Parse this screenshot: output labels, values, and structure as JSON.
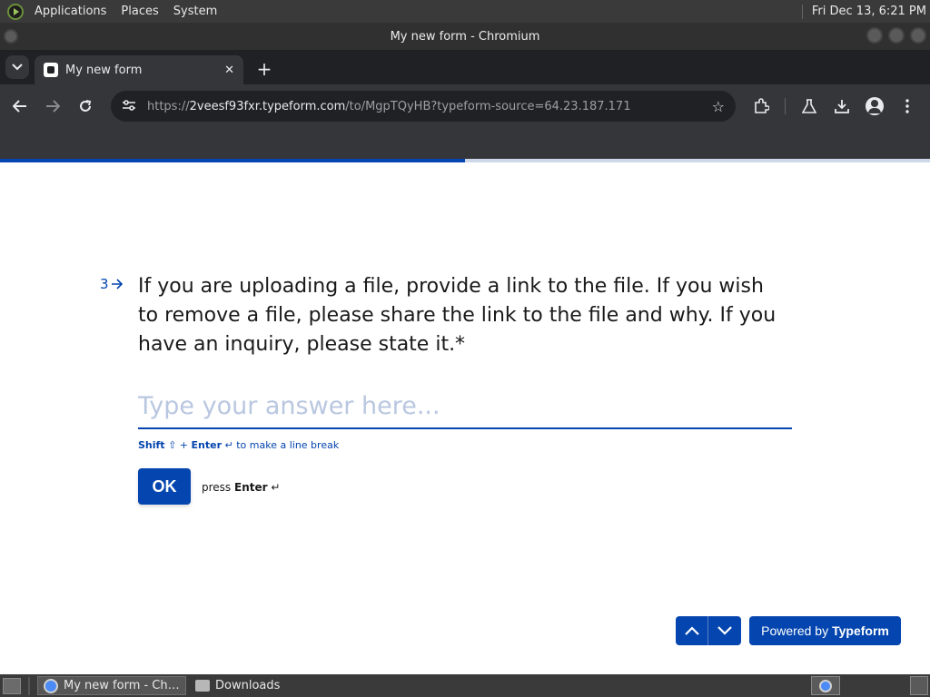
{
  "system_panel": {
    "menus": [
      "Applications",
      "Places",
      "System"
    ],
    "clock": "Fri Dec 13,  6:21 PM"
  },
  "window": {
    "title": "My new form - Chromium"
  },
  "browser": {
    "tab_title": "My new form",
    "url_prefix": "https://",
    "url_host": "2veesf93fxr.typeform.com",
    "url_path": "/to/MgpTQyHB?typeform-source=64.23.187.171"
  },
  "form": {
    "progress_fraction": 0.5,
    "question_number": "3",
    "question_text": "If you are uploading a file, provide a link to the file. If you wish to remove a file, please share the link to the file and why. If you have an inquiry, please state it.*",
    "answer_placeholder": "Type your answer here...",
    "answer_value": "",
    "hint_shift": "Shift",
    "hint_plus": "+",
    "hint_enter": "Enter",
    "hint_rest": "to make a line break",
    "ok_label": "OK",
    "press_label": "press",
    "press_enter": "Enter",
    "powered_by": "Powered by",
    "powered_brand": "Typeform"
  },
  "taskbar": {
    "tasks": [
      "My new form - Chro...",
      "Downloads"
    ]
  },
  "colors": {
    "accent": "#0445af",
    "placeholder": "#b9c7e0",
    "question_text": "#191919"
  }
}
